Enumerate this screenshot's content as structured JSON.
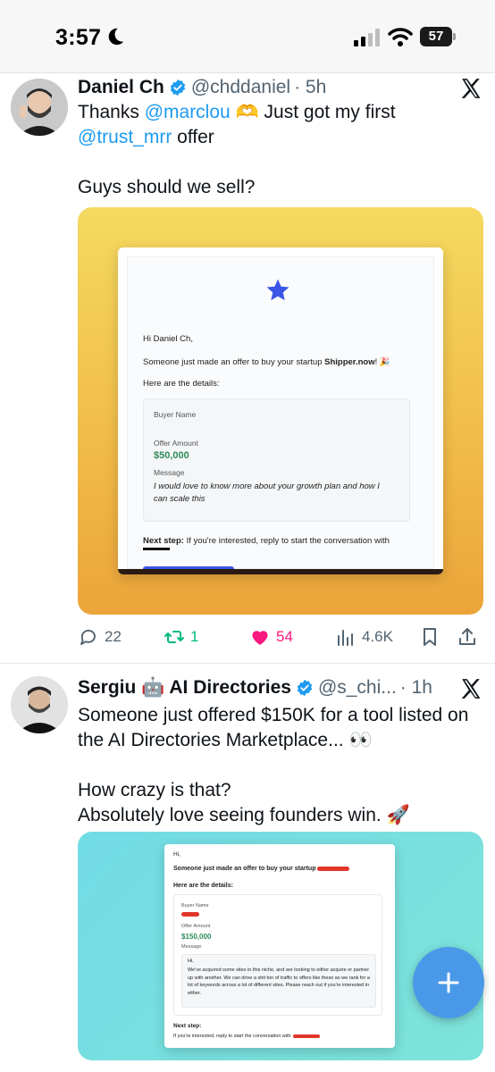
{
  "status_bar": {
    "time": "3:57",
    "battery": "57"
  },
  "tweets": [
    {
      "author": "Daniel Ch",
      "handle": "@chddaniel",
      "time": "· 5h",
      "text_pre": "Thanks ",
      "mention1": "@marclou",
      "text_mid": " 🫶 Just got my first",
      "mention2": "@trust_mrr",
      "text_after": " offer",
      "text_line2": "Guys should we sell?",
      "email": {
        "greeting": "Hi Daniel Ch,",
        "intro_pre": "Someone just made an offer to buy your startup ",
        "startup": "Shipper.now",
        "intro_post": "! 🎉",
        "details_heading": "Here are the details:",
        "buyer_label": "Buyer Name",
        "amount_label": "Offer Amount",
        "amount": "$50,000",
        "message_label": "Message",
        "message": "I would love to know more about your growth plan and how I can scale this",
        "next_step_label": "Next step:",
        "next_step_text": " If you're interested, reply to start the conversation with"
      },
      "stats": {
        "replies": "22",
        "retweets": "1",
        "likes": "54",
        "views": "4.6K"
      }
    },
    {
      "author": "Sergiu 🤖 AI Directories",
      "handle": "@s_chi...",
      "time": "· 1h",
      "text": "Someone just offered $150K for a tool listed on the AI Directories Marketplace... 👀\n\nHow crazy is that?\nAbsolutely love seeing founders win. 🚀",
      "email": {
        "greeting": "Hi,",
        "intro": "Someone just made an offer to buy your startup",
        "details_heading": "Here are the details:",
        "buyer_label": "Buyer Name",
        "amount_label": "Offer Amount",
        "amount": "$150,000",
        "message_label": "Message",
        "message_hi": "Hi,",
        "message": "We've acquired some sites in this niche, and are looking to either acquire or partner up with another. We can drive a shit ton of traffic to offers like these as we rank for a lot of keywords across a lot of different sites. Please reach out if you're interested in either.",
        "next_step_label": "Next step:",
        "next_step_text": "If you're interested, reply to start the conversation with"
      }
    }
  ],
  "colors": {
    "link": "#1d9bf0",
    "like": "#f91880",
    "retweet": "#00ba7c",
    "fab": "#4a99e9"
  },
  "icons": [
    "moon-icon",
    "signal-icon",
    "wifi-icon",
    "verified-icon",
    "x-logo-icon",
    "reply-icon",
    "retweet-icon",
    "like-icon",
    "views-icon",
    "bookmark-icon",
    "share-icon",
    "plus-icon",
    "star-icon"
  ]
}
